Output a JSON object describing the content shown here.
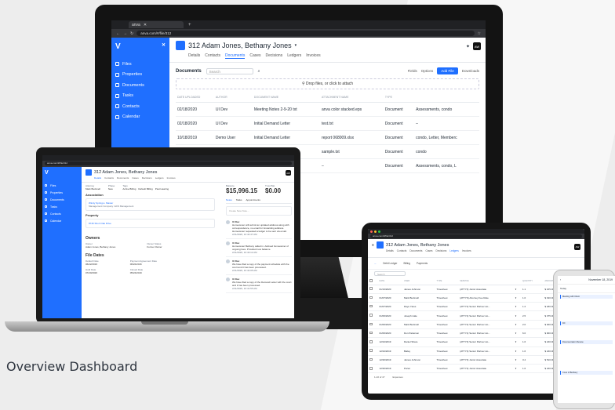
{
  "caption": "Overview Dashboard",
  "colors": {
    "brand": "#1f6fff",
    "device_dark": "#131313",
    "background": "#ededed"
  },
  "monitor": {
    "browser_tab": "anva",
    "url": "anva.com/#/file/312",
    "sidebar": {
      "logo": "V",
      "items": [
        {
          "label": "Files",
          "icon": "file-icon"
        },
        {
          "label": "Properties",
          "icon": "building-icon"
        },
        {
          "label": "Documents",
          "icon": "document-icon"
        },
        {
          "label": "Tasks",
          "icon": "checklist-icon"
        },
        {
          "label": "Contacts",
          "icon": "person-icon"
        },
        {
          "label": "Calendar",
          "icon": "calendar-icon"
        }
      ]
    },
    "title": "312  Adam Jones, Bethany Jones",
    "tabs": [
      "Details",
      "Contacts",
      "Documents",
      "Cases",
      "Decisions",
      "Ledgers",
      "Invoices"
    ],
    "active_tab": "Documents",
    "avatar": "AW",
    "docs": {
      "title": "Documents",
      "search_placeholder": "Search",
      "fields_label": "Fields",
      "options_label": "Options",
      "add_label": "Add File",
      "downloads_label": "Downloads",
      "drop_text": "Drop files, or click to attach",
      "columns": [
        "DATE UPLOADED",
        "AUTHOR",
        "DOCUMENT NAME",
        "ATTACHMENT NAME",
        "TYPE",
        ""
      ],
      "rows": [
        [
          "02/18/2020",
          "UI Dev",
          "Meeting Notes 2-9-20 txt",
          "anva color stacked.eps",
          "Document",
          "Assessments, condo"
        ],
        [
          "02/18/2020",
          "UI Dev",
          "Initial Demand Letter",
          "test.txt",
          "Document",
          "–"
        ],
        [
          "10/18/2019",
          "Demo User",
          "Initial Demand Letter",
          "report 068009.xlsx",
          "Document",
          "condo, Letter, Memberc"
        ],
        [
          "10/18/2019",
          "Administrator",
          "2nd Demand Letter",
          "sample.txt",
          "Document",
          "condo"
        ],
        [
          "",
          "",
          "attachment",
          "–",
          "Document",
          "Assessments, condo, L"
        ]
      ]
    }
  },
  "laptop": {
    "title": "312  Adam Jones, Bethany Jones",
    "tabs": [
      "Details",
      "Contacts",
      "Documents",
      "Cases",
      "Decisions",
      "Ledgers",
      "Invoices"
    ],
    "attorney_label": "Attorney",
    "attorney": "Mark Bucknell",
    "phase_label": "Phase",
    "phase": "New",
    "tags_label": "Tags",
    "tags": [
      "Active Billing",
      "Default Billing",
      "Past Hearing"
    ],
    "association_label": "Association",
    "association_name": "Windy Springs • Master",
    "association_sub": "Management Company: ECS Management",
    "property_label": "Property",
    "property": "8746 Short Oak Drive",
    "owners_label": "Owners",
    "owner_name_label": "Owner",
    "owner_name": "Adam Jones, Bethany Jones",
    "owner_status_label": "Owner Status",
    "owner_status": "Former Owner",
    "dates_label": "File Dates",
    "default_date_label": "Default Date",
    "default_date": "06/22/2016",
    "payment_label": "Payment Agreement Date",
    "payment_date": "06/22/2016",
    "hold_label": "Hold Date",
    "hold_date": "07/20/2020",
    "closed_label": "Closed Date",
    "closed_date": "05/24/2019",
    "balance_label": "Balance",
    "balance": "$15,996.15",
    "trust_label": "Trust Bal.",
    "trust": "$0.00",
    "note_tabs": [
      "Notes",
      "Tasks",
      "Appointments"
    ],
    "note_placeholder": "Create New Note...",
    "notes": [
      {
        "author": "UI Dev",
        "text": "Homeowner will submit an updated address along with correspondence, no email for forwarding address. Homeowner requested a ledger to be sent via email.",
        "time": "2/11/2020, 10:44:47 AM"
      },
      {
        "author": "UI Dev",
        "text": "Homeowner Bethany called in. Advised homeowner of ongoing fees. Provided new balance.",
        "time": "2/11/2020, 10:43:12 AM"
      },
      {
        "author": "UI Dev",
        "text": "We have filed a copy of the payment schedule with the court and it has been processed.",
        "time": "2/11/2020, 10:42:05 AM"
      },
      {
        "author": "UI Dev",
        "text": "We have filed a copy of the Demand Letter with the court and it has been processed.",
        "time": "2/11/2020, 10:41:55 AM"
      }
    ]
  },
  "tablet": {
    "title": "312  Adam Jones, Bethany Jones",
    "tabs": [
      "Details",
      "Contacts",
      "Documents",
      "Cases",
      "Decisions",
      "Ledgers",
      "Invoices"
    ],
    "subtabs": [
      "Debit Ledger",
      "Billing",
      "Payments"
    ],
    "search_placeholder": "Search",
    "columns": [
      "",
      "DATE",
      "USER",
      "TYPE",
      "SERVICE",
      "",
      "QUANTITY",
      "AMOUNT",
      "BILLABLE"
    ],
    "rows": [
      [
        "01/13/2020",
        "James Johnson",
        "Timesheet",
        "(ATTY3) Junior Associate",
        "1.1",
        "$ 165.00"
      ],
      [
        "01/07/2020",
        "Mark Bucknell",
        "Timesheet",
        "(ATTYS) Attorney Fee Rate",
        "1.0",
        "$ 190.00"
      ],
      [
        "01/07/2020",
        "Daye Yares",
        "Timesheet",
        "(ATTY2) Senior Partner Ho...",
        "1.2",
        "$ 180.00"
      ],
      [
        "01/06/2020",
        "Joseph Hale",
        "Timesheet",
        "(ATTY2) Senior Partner Ho...",
        "2.5",
        "$ 375.00"
      ],
      [
        "01/06/2020",
        "Mark Bucknell",
        "Timesheet",
        "(ATTY2) Senior Partner Ho...",
        "2.0",
        "$ 300.00"
      ],
      [
        "01/06/2020",
        "Don Patterson",
        "Timesheet",
        "(ATTY2) Senior Partner Ho...",
        "6.0",
        "$ 900.00"
      ],
      [
        "12/24/2019",
        "Daniel Share",
        "Timesheet",
        "(ATTY3) Senior Partner Ho...",
        "1.6",
        "$ 240.00"
      ],
      [
        "12/24/2019",
        "Bailey",
        "Timesheet",
        "(ATTY3) Senior Partner Ho...",
        "1.6",
        "$ 240.00"
      ],
      [
        "12/20/2019",
        "James Johnson",
        "Timesheet",
        "(ATTY3) Junior Associate",
        "3.4",
        "$ 510.00"
      ],
      [
        "12/20/2019",
        "Porter",
        "Timesheet",
        "(ATTY3) Junior Associate",
        "1.6",
        "$ 240.00"
      ]
    ],
    "footer": "1-10 of 47",
    "footer_action": "Expenses"
  },
  "phone": {
    "date": "November 18, 2019",
    "view": "Today",
    "events": [
      "Meeting with Client",
      "Fill",
      "Documentation Review",
      "Cone of Bethany"
    ]
  }
}
